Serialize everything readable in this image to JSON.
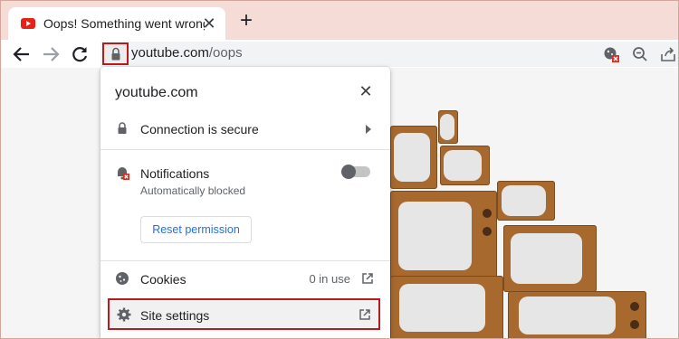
{
  "tab": {
    "title": "Oops! Something went wrong. -",
    "close": "✕"
  },
  "toolbar": {
    "new_tab": "+",
    "url_host": "youtube.com",
    "url_path": "/oops"
  },
  "popup": {
    "title": "youtube.com",
    "close": "✕",
    "connection_label": "Connection is secure",
    "notifications_label": "Notifications",
    "notifications_status": "Automatically blocked",
    "reset_button": "Reset permission",
    "cookies_label": "Cookies",
    "cookies_count": "0 in use",
    "site_settings_label": "Site settings"
  },
  "colors": {
    "tabstrip": "#f6dcd6",
    "highlight": "#b71c1c",
    "link": "#1a73e8"
  },
  "icons": [
    "youtube-favicon",
    "back-arrow-icon",
    "forward-arrow-icon",
    "reload-icon",
    "lock-icon",
    "blocked-permission-icon",
    "zoom-icon",
    "share-icon",
    "bell-blocked-icon",
    "cookie-icon",
    "external-link-icon",
    "gear-icon",
    "chevron-right-icon",
    "close-icon",
    "plus-icon"
  ]
}
